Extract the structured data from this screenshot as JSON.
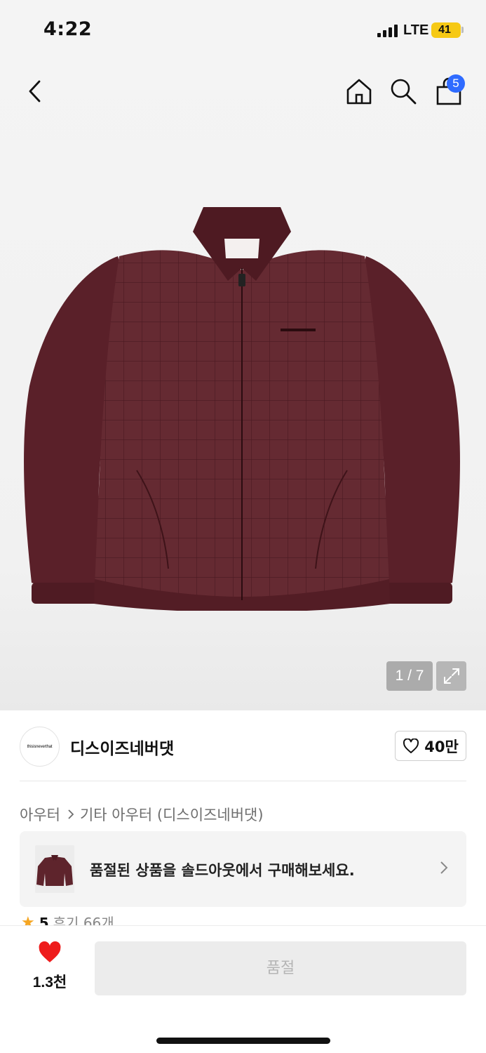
{
  "status_bar": {
    "time": "4:22",
    "network": "LTE",
    "battery": "41"
  },
  "nav": {
    "cart_count": "5"
  },
  "gallery": {
    "counter": "1 / 7"
  },
  "brand": {
    "logo_text": "thisisneverthat",
    "name": "디스이즈네버댓",
    "likes": "40만"
  },
  "breadcrumb": {
    "items": [
      "아우터",
      "기타 아우터 (디스이즈네버댓)"
    ]
  },
  "soldout_banner": {
    "text": "품절된 상품을 솔드아웃에서 구매해보세요."
  },
  "reviews": {
    "score": "5",
    "label": "후기 66개"
  },
  "bottom_bar": {
    "wish_count": "1.3천",
    "action_label": "품절"
  },
  "colors": {
    "accent_blue": "#2f6bff",
    "heart_red": "#ee1c1c",
    "battery_yellow": "#f6c915",
    "jacket": "#5e242c"
  },
  "icons": [
    "back-icon",
    "home-icon",
    "search-icon",
    "bag-icon",
    "expand-icon",
    "heart-outline-icon",
    "chevron-right-icon",
    "star-icon",
    "heart-filled-icon"
  ]
}
